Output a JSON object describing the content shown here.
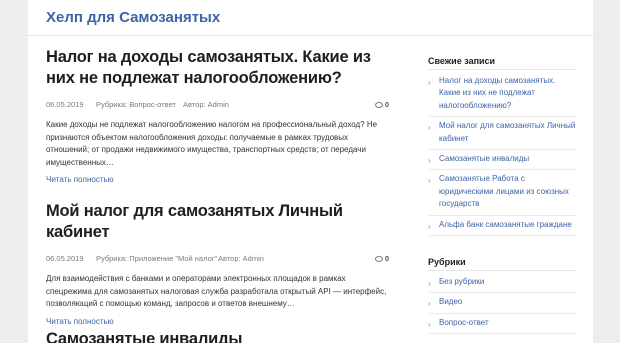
{
  "site": {
    "title": "Хелп для Самозанятых"
  },
  "posts": [
    {
      "title": "Налог на доходы самозанятых. Какие из них не подлежат налогообложению?",
      "date": "06.05.2019",
      "category": "Рубрика: Вопрос-ответ",
      "author": "Автор: Admin",
      "comments": "0",
      "excerpt": "Какие доходы не подлежат налогообложению налогом на профессиональный доход? Не признаются объектом налогообложения доходы: получаемые в рамках трудовых отношений; от продажи недвижимого имущества, транспортных средств; от передачи имущественных…",
      "read_more": "Читать полностью"
    },
    {
      "title": "Мой налог для самозанятых Личный кабинет",
      "date": "06.05.2019",
      "category": "Рубрика: Приложение \"Мой налог\"",
      "author": "Автор: Admin",
      "comments": "0",
      "excerpt": "Для взаимодействия с банками и операторами электронных площадок в рамках спецрежима для самозанятых налоговая служба разработала открытый API — интерфейс, позволяющий с помощью команд, запросов и ответов внешнему…",
      "read_more": "Читать полностью"
    },
    {
      "title": "Самозанятые инвалиды"
    }
  ],
  "sidebar": {
    "recent": {
      "title": "Свежие записи",
      "items": [
        "Налог на доходы самозанятых. Какие из них не подлежат налогообложению?",
        "Мой налог для самозанятых Личный кабинет",
        "Самозанятые инвалиды",
        "Самозанятые Работа с юридическими лицами из союзных государств",
        "Альфа банк самозанятые граждане"
      ]
    },
    "categories": {
      "title": "Рубрики",
      "items": [
        "Без рубрики",
        "Видео",
        "Вопрос-ответ"
      ]
    }
  }
}
